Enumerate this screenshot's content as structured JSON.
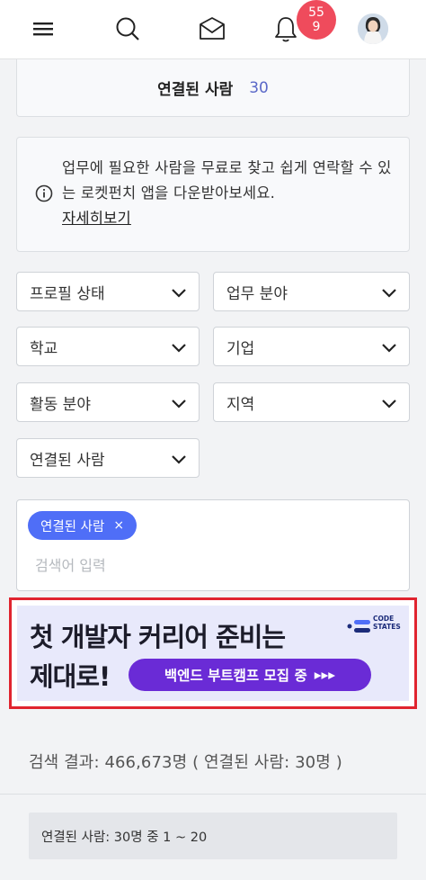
{
  "header": {
    "notification_count": "55\n9",
    "notification_count_line1": "55",
    "notification_count_line2": "9"
  },
  "connected": {
    "label": "연결된 사람",
    "count": "30"
  },
  "info": {
    "text": "업무에 필요한 사람을 무료로 찾고 쉽게 연락할 수 있는 로켓펀치 앱을 다운받아보세요.",
    "link": "자세히보기"
  },
  "filters": {
    "profile_status": "프로필 상태",
    "work_field": "업무 분야",
    "school": "학교",
    "company": "기업",
    "activity_field": "활동 분야",
    "region": "지역",
    "connected_people": "연결된 사람"
  },
  "tags": {
    "chip_label": "연결된 사람",
    "chip_close": "×",
    "search_placeholder": "검색어 입력"
  },
  "banner": {
    "line1_prefix": "첫 개발자 커리어 준비",
    "line1_highlight": "는",
    "line2": "제대로!",
    "pill_text": "백엔드 부트캠프 모집 중",
    "pill_arrows": "▸▸▸",
    "logo_line1": "CODE",
    "logo_line2": "STATES",
    "accent_color": "#6a2bd6"
  },
  "results": {
    "summary": "검색 결과: 466,673명 ( 연결된 사람: 30명 )",
    "pager": "연결된 사람: 30명 중 1 ~ 20"
  }
}
